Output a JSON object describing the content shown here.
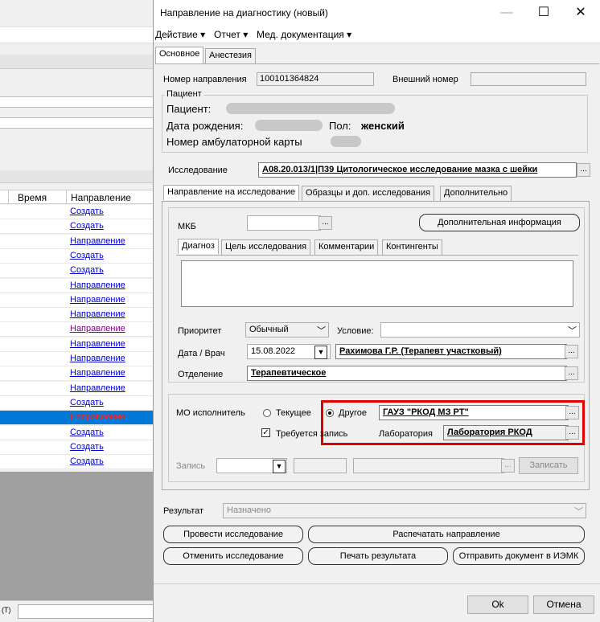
{
  "background": {
    "table_headers": [
      "Время",
      "Направление"
    ],
    "rows": [
      {
        "label": "Создать",
        "state": "normal"
      },
      {
        "label": "Создать",
        "state": "normal"
      },
      {
        "label": "Направление",
        "state": "normal"
      },
      {
        "label": "Создать",
        "state": "normal"
      },
      {
        "label": "Создать",
        "state": "normal"
      },
      {
        "label": "Направление",
        "state": "normal"
      },
      {
        "label": "Направление",
        "state": "normal"
      },
      {
        "label": "Направление",
        "state": "normal"
      },
      {
        "label": "Направление",
        "state": "visited"
      },
      {
        "label": "Направление",
        "state": "normal"
      },
      {
        "label": "Направление",
        "state": "normal"
      },
      {
        "label": "Направление",
        "state": "normal"
      },
      {
        "label": "Направление",
        "state": "normal"
      },
      {
        "label": "Создать",
        "state": "normal"
      },
      {
        "label": "Направление",
        "state": "selected"
      },
      {
        "label": "Создать",
        "state": "normal"
      },
      {
        "label": "Создать",
        "state": "normal"
      },
      {
        "label": "Создать",
        "state": "normal"
      }
    ],
    "bottom_label": "(Т)"
  },
  "dialog": {
    "title": "Направление на диагностику (новый)",
    "window_buttons": {
      "minimize": "—",
      "maximize": "☐",
      "close": "✕"
    },
    "menu": [
      "Действие ▾",
      "Отчет ▾",
      "Мед. документация ▾"
    ],
    "tabs": [
      "Основное",
      "Анестезия"
    ],
    "direction_number_label": "Номер направления",
    "direction_number": "100101364824",
    "external_number_label": "Внешний номер",
    "external_number": "",
    "patient_group_title": "Пациент",
    "patient_label": "Пациент:",
    "birth_label": "Дата рождения:",
    "sex_label": "Пол:",
    "sex_value": "женский",
    "card_label": "Номер амбулаторной карты",
    "study_label": "Исследование",
    "study_value": "A08.20.013/1|П39 Цитологическое исследование мазка с шейки",
    "sub_tabs": [
      "Направление на исследование",
      "Образцы и доп. исследования",
      "Дополнительно"
    ],
    "mkb_label": "МКБ",
    "extra_info_button": "Дополнительная информация",
    "diag_tabs": [
      "Диагноз",
      "Цель исследования",
      "Комментарии",
      "Контингенты"
    ],
    "priority_label": "Приоритет",
    "priority_value": "Обычный",
    "condition_label": "Условие:",
    "date_doctor_label": "Дата / Врач",
    "date_value": "15.08.2022",
    "doctor_value": "Рахимова Г.Р. (Терапевт участковый)",
    "department_label": "Отделение",
    "department_value": "Терапевтическое",
    "mo_label": "МО исполнитель",
    "radio_current": "Текущее",
    "radio_other": "Другое",
    "mo_value": "ГАУЗ \"РКОД МЗ РТ\"",
    "need_record_label": "Требуется запись",
    "lab_label": "Лаборатория",
    "lab_value": "Лаборатория РКОД",
    "record_label": "Запись",
    "record_button": "Записать",
    "result_label": "Результат",
    "result_value": "Назначено",
    "buttons": {
      "conduct": "Провести исследование",
      "print_direction": "Распечатать направление",
      "cancel_study": "Отменить исследование",
      "print_result": "Печать результата",
      "send_iemk": "Отправить документ в ИЭМК",
      "ok": "Ok",
      "cancel": "Отмена"
    },
    "highlight_color": "#e00000"
  }
}
